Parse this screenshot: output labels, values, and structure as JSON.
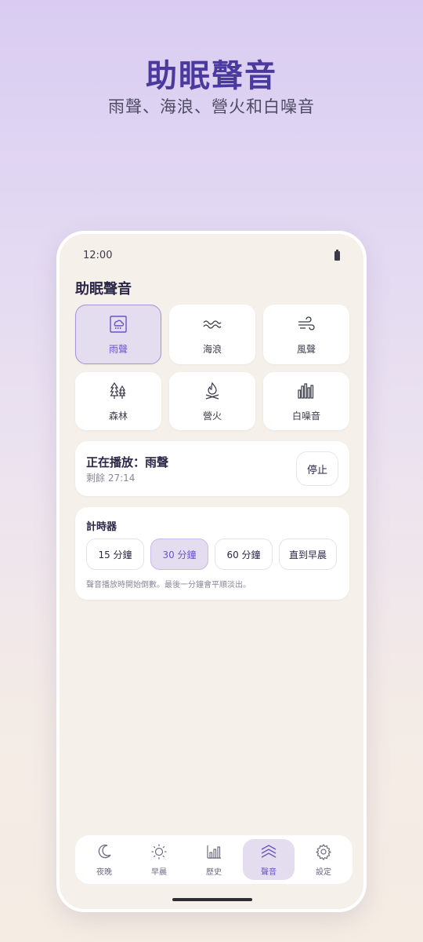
{
  "hero": {
    "title": "助眠聲音",
    "subtitle": "雨聲、海浪、營火和白噪音"
  },
  "status_bar": {
    "time": "12:00",
    "battery_icon": "battery-icon"
  },
  "app": {
    "title": "助眠聲音"
  },
  "sounds": [
    {
      "label": "雨聲",
      "icon": "rain-icon",
      "selected": true
    },
    {
      "label": "海浪",
      "icon": "waves-icon",
      "selected": false
    },
    {
      "label": "風聲",
      "icon": "wind-icon",
      "selected": false
    },
    {
      "label": "森林",
      "icon": "forest-icon",
      "selected": false
    },
    {
      "label": "營火",
      "icon": "campfire-icon",
      "selected": false
    },
    {
      "label": "白噪音",
      "icon": "white-noise-icon",
      "selected": false
    }
  ],
  "now_playing": {
    "title": "正在播放：雨聲",
    "remaining": "剩餘 27:14",
    "stop_label": "停止"
  },
  "timer": {
    "title": "計時器",
    "options": [
      "15 分鐘",
      "30 分鐘",
      "60 分鐘",
      "直到早晨"
    ],
    "selected": "30 分鐘",
    "note": "聲音播放時開始倒數。最後一分鐘會平順淡出。"
  },
  "nav": [
    {
      "label": "夜晚",
      "icon": "moon-icon",
      "active": false
    },
    {
      "label": "早晨",
      "icon": "sun-icon",
      "active": false
    },
    {
      "label": "歷史",
      "icon": "chart-icon",
      "active": false
    },
    {
      "label": "聲音",
      "icon": "sound-waves-icon",
      "active": true
    },
    {
      "label": "設定",
      "icon": "gear-icon",
      "active": false
    }
  ],
  "colors": {
    "accent": "#6a55c2",
    "accent_bg": "#e4dcef",
    "hero_title": "#4a3a9e"
  }
}
